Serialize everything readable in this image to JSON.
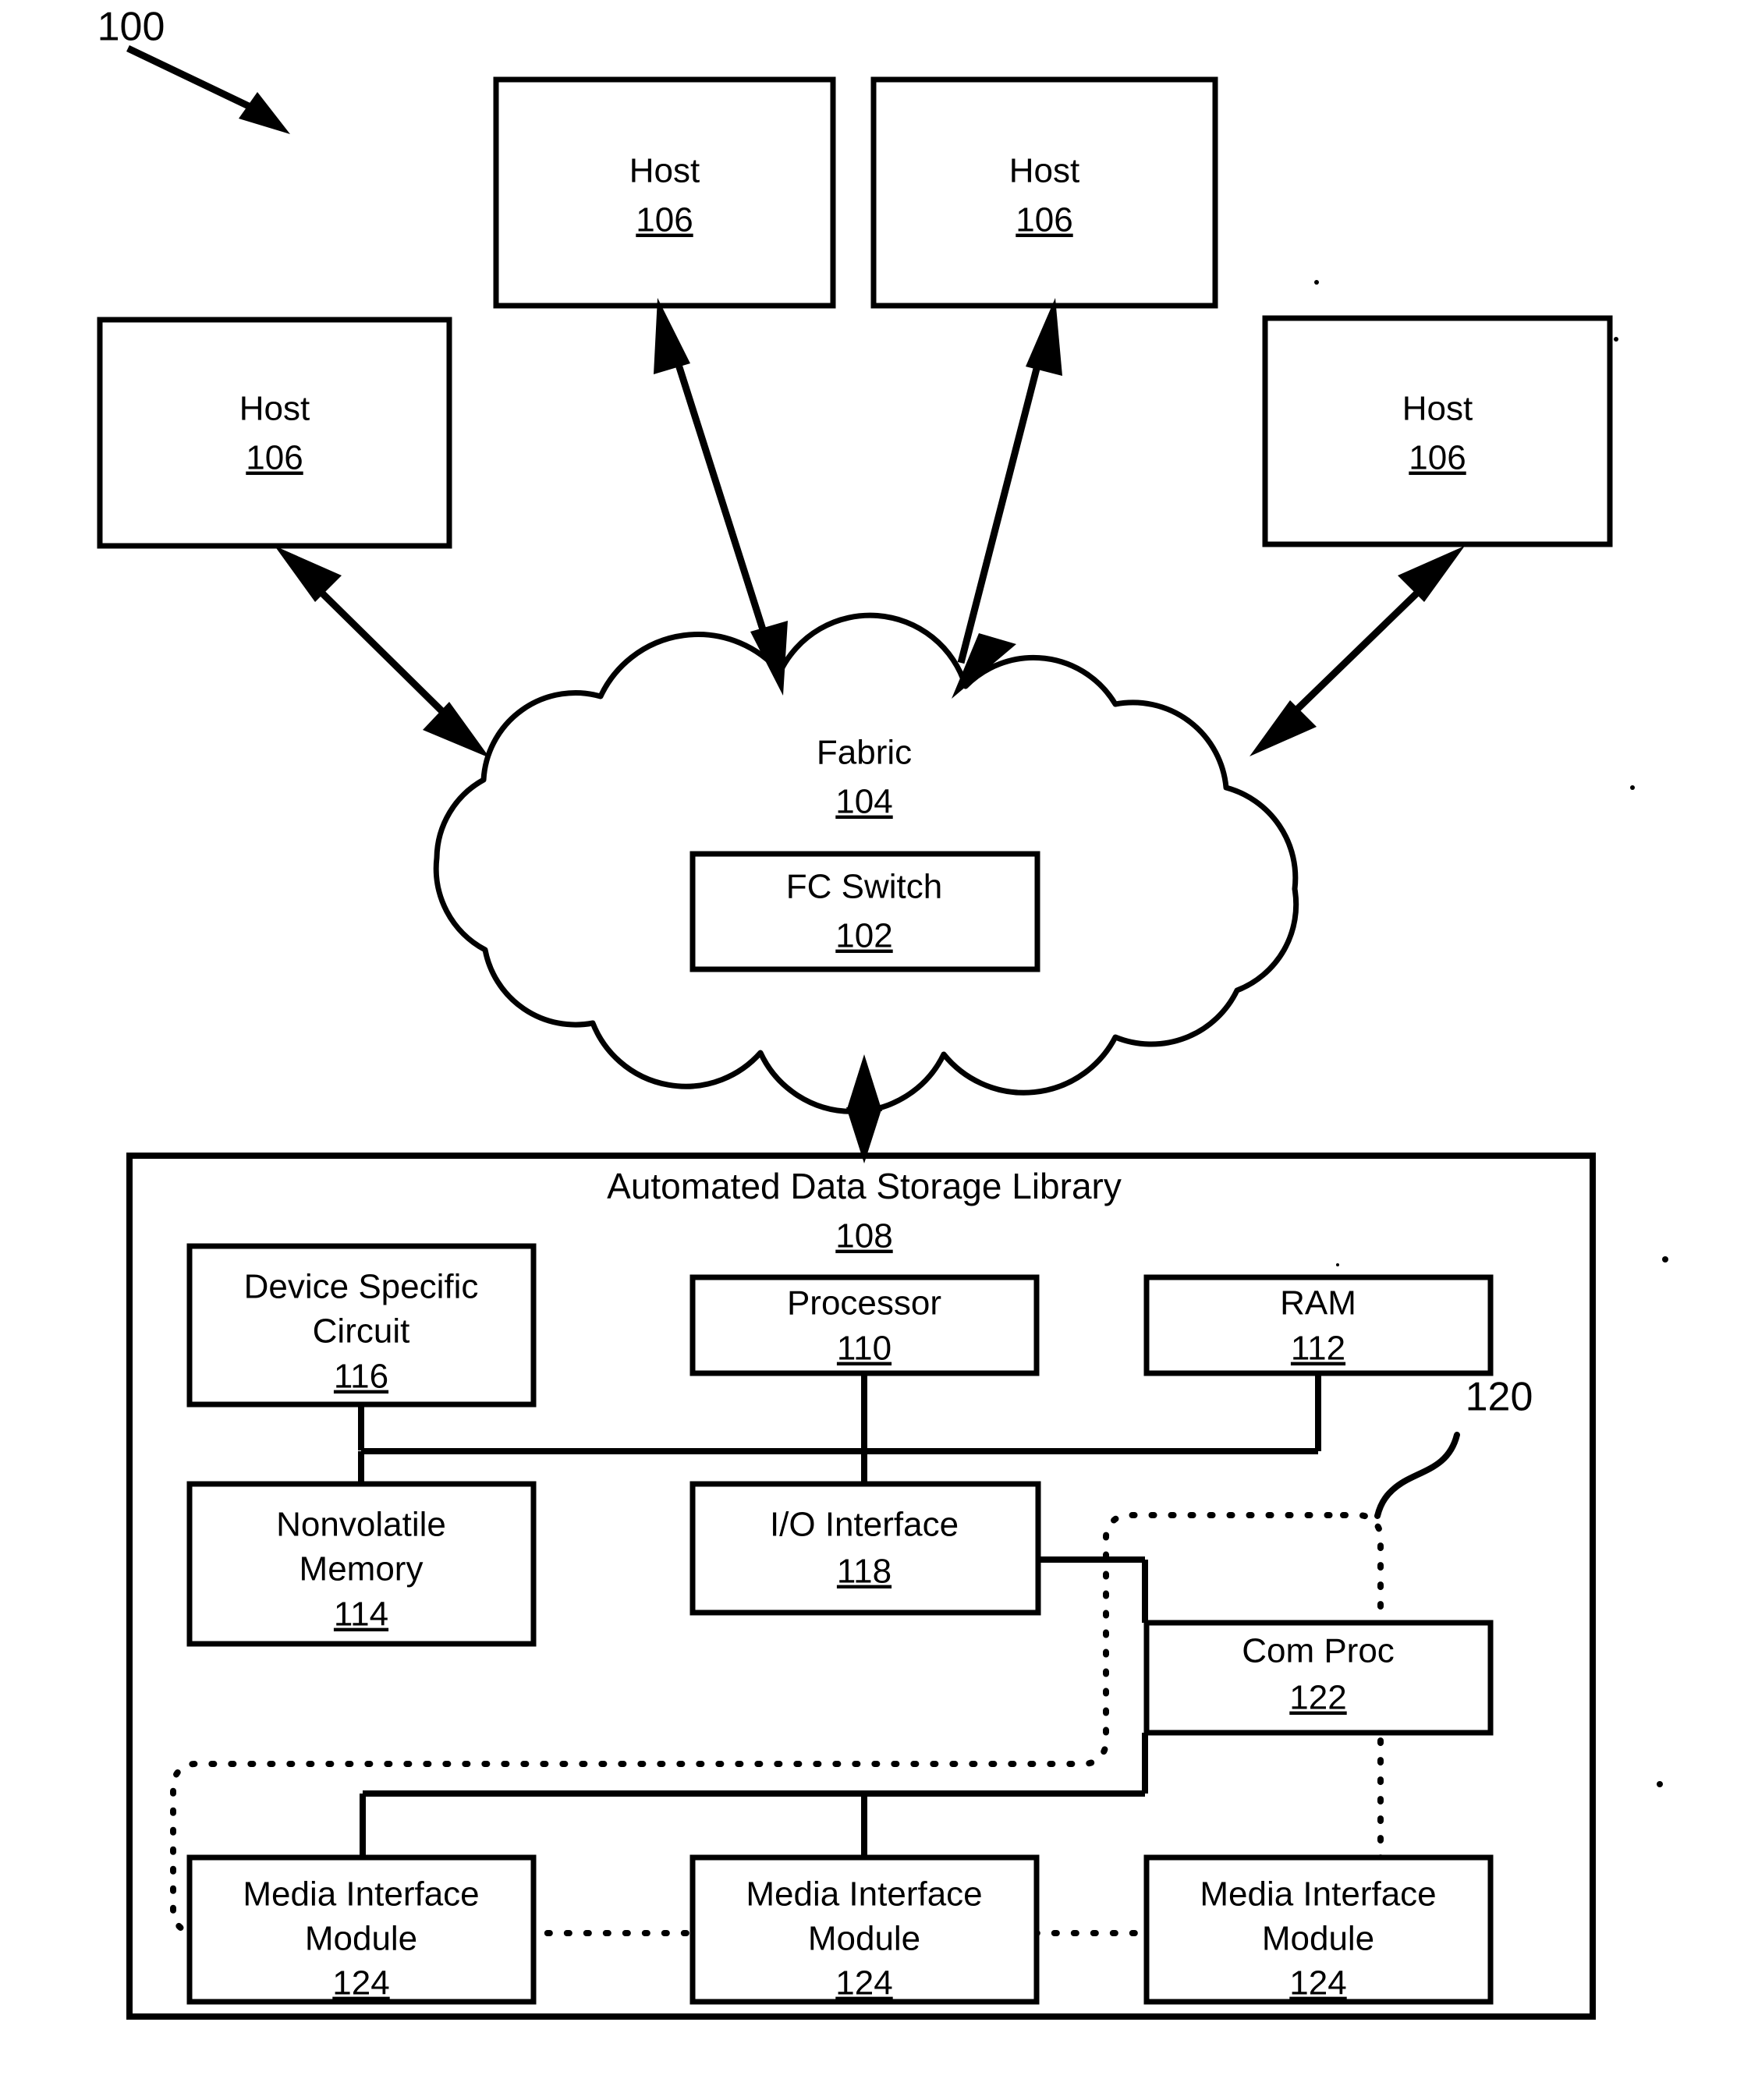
{
  "figure": {
    "figure_number": "100",
    "hosts": [
      {
        "label": "Host",
        "ref": "106"
      },
      {
        "label": "Host",
        "ref": "106"
      },
      {
        "label": "Host",
        "ref": "106"
      },
      {
        "label": "Host",
        "ref": "106"
      }
    ],
    "fabric": {
      "label": "Fabric",
      "ref": "104",
      "switch": {
        "label": "FC Switch",
        "ref": "102"
      }
    },
    "library": {
      "label": "Automated Data Storage Library",
      "ref": "108",
      "components": {
        "device_specific_circuit": {
          "line1": "Device Specific",
          "line2": "Circuit",
          "ref": "116"
        },
        "processor": {
          "label": "Processor",
          "ref": "110"
        },
        "ram": {
          "label": "RAM",
          "ref": "112"
        },
        "nonvolatile_memory": {
          "line1": "Nonvolatile",
          "line2": "Memory",
          "ref": "114"
        },
        "io_interface": {
          "label": "I/O Interface",
          "ref": "118"
        },
        "com_proc": {
          "label": "Com Proc",
          "ref": "122"
        },
        "media_modules": [
          {
            "line1": "Media Interface",
            "line2": "Module",
            "ref": "124"
          },
          {
            "line1": "Media Interface",
            "line2": "Module",
            "ref": "124"
          },
          {
            "line1": "Media Interface",
            "line2": "Module",
            "ref": "124"
          }
        ]
      },
      "dotted_region_ref": "120"
    }
  },
  "colors": {
    "ink": "#000000",
    "paper": "#ffffff"
  }
}
